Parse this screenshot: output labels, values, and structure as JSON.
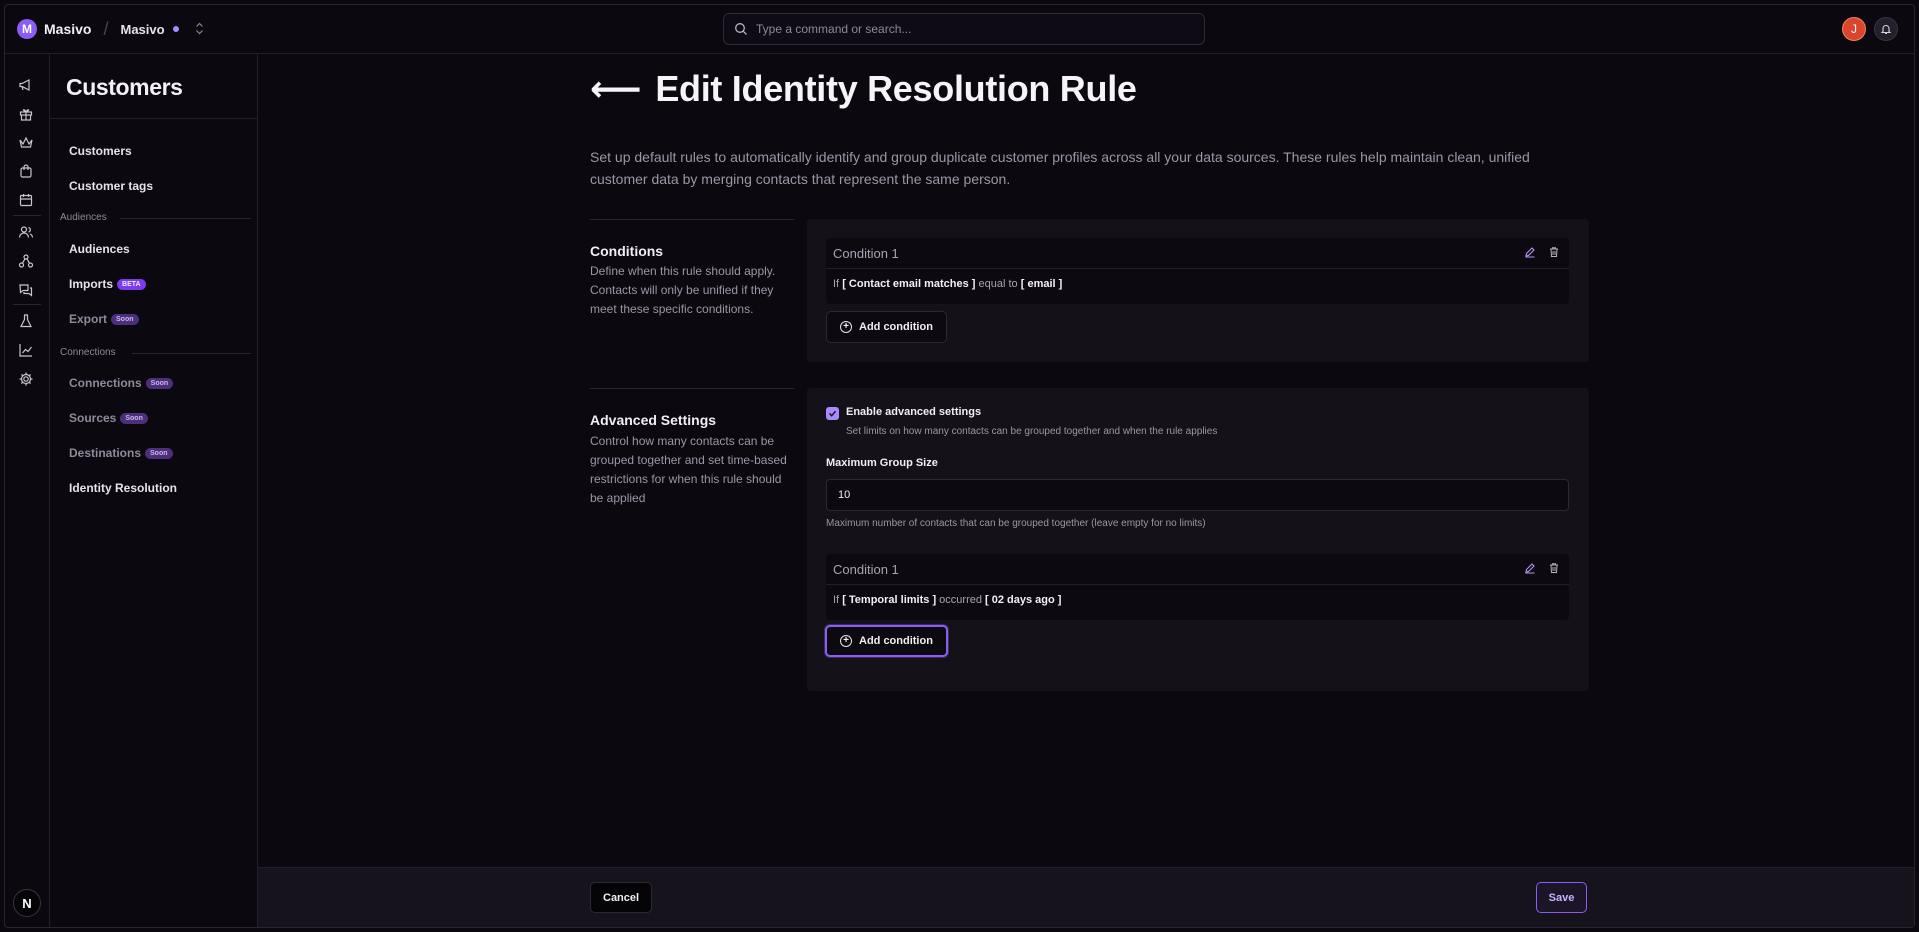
{
  "topbar": {
    "brand_initial": "M",
    "brand_name": "Masivo",
    "org_name": "Masivo",
    "search_placeholder": "Type a command or search...",
    "avatar_initial": "J"
  },
  "rail": {
    "bottom_initial": "N"
  },
  "sidenav": {
    "title": "Customers",
    "items": {
      "customers": "Customers",
      "customer_tags": "Customer tags",
      "audiences_section": "Audiences",
      "audiences": "Audiences",
      "imports": "Imports",
      "imports_badge": "BETA",
      "export": "Export",
      "export_badge": "Soon",
      "connections_section": "Connections",
      "connections": "Connections",
      "connections_badge": "Soon",
      "sources": "Sources",
      "sources_badge": "Soon",
      "destinations": "Destinations",
      "destinations_badge": "Soon",
      "identity_resolution": "Identity Resolution"
    }
  },
  "main": {
    "title": "Edit Identity Resolution Rule",
    "back_arrow": "⟵",
    "description": "Set up default rules to automatically identify and group duplicate customer profiles across all your data sources. These rules help maintain clean, unified customer data by merging contacts that represent the same person.",
    "conditions": {
      "title": "Conditions",
      "description": "Define when this rule should apply. Contacts will only be unified if they meet these specific conditions.",
      "card": {
        "title": "Condition 1",
        "if": "If",
        "field": "[ Contact email matches ]",
        "operator": "equal to",
        "value": "[ email ]"
      },
      "add_label": "Add condition"
    },
    "advanced": {
      "title": "Advanced Settings",
      "description": "Control how many contacts can be grouped together and set time-based restrictions for when this rule should be applied",
      "enable_label": "Enable advanced settings",
      "enable_checked": true,
      "enable_help": "Set limits on how many contacts can be grouped together and when the rule applies",
      "max_group_label": "Maximum Group Size",
      "max_group_value": "10",
      "max_group_help": "Maximum number of contacts that can be grouped together (leave empty for no limits)",
      "card": {
        "title": "Condition 1",
        "if": "If",
        "field": "[ Temporal limits ]",
        "operator": "occurred",
        "value": "[ 02 days ago ]"
      },
      "add_label": "Add condition"
    }
  },
  "footer": {
    "cancel_label": "Cancel",
    "save_label": "Save"
  },
  "colors": {
    "accent": "#8b5cf6",
    "background": "#0b0810",
    "panel": "#151119"
  }
}
